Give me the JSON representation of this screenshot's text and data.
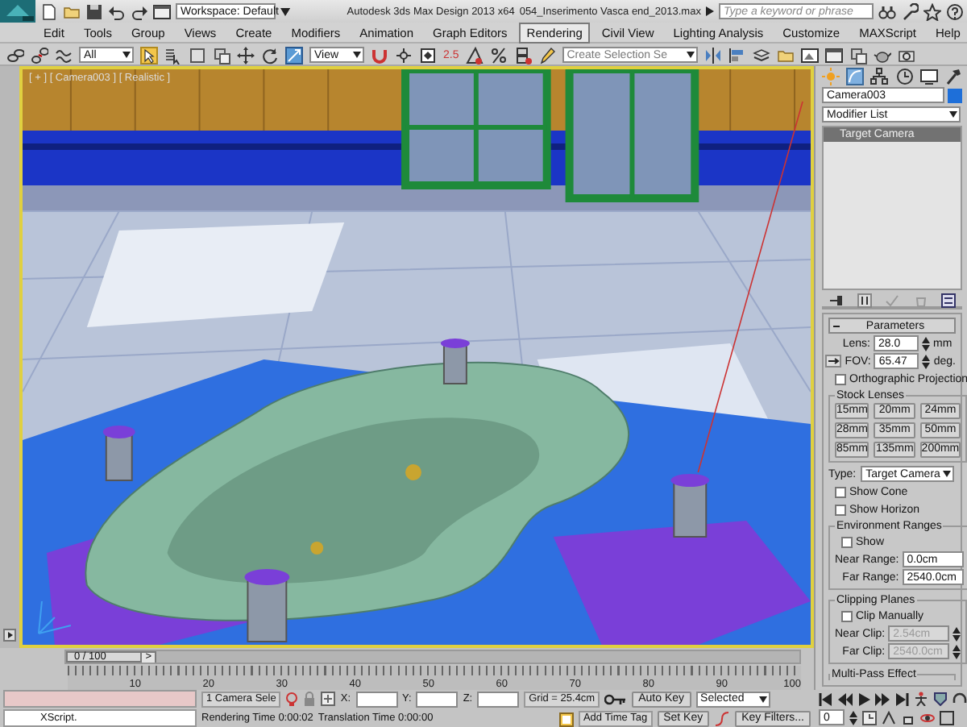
{
  "title_bar": {
    "workspace": "Workspace: Default",
    "app_title": "Autodesk 3ds Max Design 2013 x64",
    "file_name": "054_Inserimento Vasca end_2013.max",
    "search": {
      "placeholder": "Type a keyword or phrase"
    }
  },
  "menu": [
    {
      "label": "Edit",
      "selected": false
    },
    {
      "label": "Tools",
      "selected": false
    },
    {
      "label": "Group",
      "selected": false
    },
    {
      "label": "Views",
      "selected": false
    },
    {
      "label": "Create",
      "selected": false
    },
    {
      "label": "Modifiers",
      "selected": false
    },
    {
      "label": "Animation",
      "selected": false
    },
    {
      "label": "Graph Editors",
      "selected": false
    },
    {
      "label": "Rendering",
      "selected": true
    },
    {
      "label": "Civil View",
      "selected": false
    },
    {
      "label": "Lighting Analysis",
      "selected": false
    },
    {
      "label": "Customize",
      "selected": false
    },
    {
      "label": "MAXScript",
      "selected": false
    },
    {
      "label": "Help",
      "selected": false
    }
  ],
  "main_toolbar": {
    "selection_filter": "All",
    "reference_coordinate_system": "View",
    "snap_value": "2.5",
    "named_selection_set": {
      "placeholder": "Create Selection Se"
    }
  },
  "viewport": {
    "label": "[ + ] [ Camera003 ] [ Realistic ]",
    "active": true
  },
  "command_panel": {
    "object_name": "Camera003",
    "modifier_list": "Modifier List",
    "stack": [
      {
        "label": "Target Camera",
        "selected": true
      }
    ],
    "rollout": "Parameters",
    "lens": {
      "label": "Lens:",
      "value": "28.0",
      "unit": "mm"
    },
    "fov": {
      "label": "FOV:",
      "value": "65.47",
      "unit": "deg."
    },
    "orthographic": {
      "label": "Orthographic Projection",
      "checked": false
    },
    "stock_lenses": {
      "title": "Stock Lenses",
      "buttons": [
        "15mm",
        "20mm",
        "24mm",
        "28mm",
        "35mm",
        "50mm",
        "85mm",
        "135mm",
        "200mm"
      ]
    },
    "type": {
      "label": "Type:",
      "value": "Target Camera"
    },
    "show_cone": {
      "label": "Show Cone",
      "checked": false
    },
    "show_horizon": {
      "label": "Show Horizon",
      "checked": false
    },
    "environment_ranges": {
      "title": "Environment Ranges",
      "show": {
        "label": "Show",
        "checked": false
      },
      "fields": [
        {
          "label": "Near Range:",
          "value": "0.0cm",
          "disabled": false
        },
        {
          "label": "Far Range:",
          "value": "2540.0cm",
          "disabled": false
        }
      ]
    },
    "clipping_planes": {
      "title": "Clipping Planes",
      "clip_manually": {
        "label": "Clip Manually",
        "checked": false
      },
      "fields": [
        {
          "label": "Near Clip:",
          "value": "2.54cm",
          "disabled": true
        },
        {
          "label": "Far Clip:",
          "value": "2540.0cm",
          "disabled": true
        }
      ]
    },
    "multi_pass": "Multi-Pass Effect"
  },
  "time_slider": {
    "label": "0 / 100",
    "next": ">"
  },
  "track_bar": {
    "ticks": [
      "10",
      "20",
      "30",
      "40",
      "50",
      "60",
      "70",
      "80",
      "90",
      "100"
    ]
  },
  "status_bar": {
    "listener_output": "XScript.",
    "selection": "1 Camera Sele",
    "x_label": "X:",
    "y_label": "Y:",
    "z_label": "Z:",
    "grid": "Grid = 25.4cm",
    "prompt": "Rendering Time  0:00:02",
    "translation": "Translation Time  0:00:00",
    "add_time_tag": "Add Time Tag",
    "auto_key": "Auto Key",
    "set_key": "Set Key",
    "key_mode": "Selected",
    "key_filters": "Key Filters..."
  },
  "playback": {
    "frame": "0"
  }
}
